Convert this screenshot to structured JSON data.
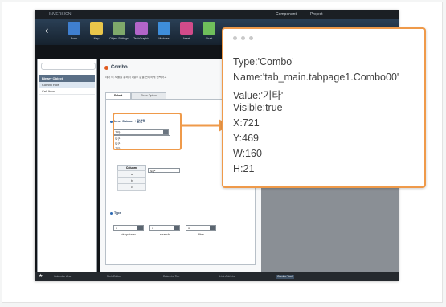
{
  "app": {
    "brand": "INVERSION",
    "top_items": [
      "Component",
      "Project"
    ],
    "toolbar_buttons": [
      {
        "label": "Form",
        "color": "#3f7fcf"
      },
      {
        "label": "Map",
        "color": "#e9c64a"
      },
      {
        "label": "Object Settings",
        "color": "#7fa96b"
      },
      {
        "label": "TechGraphic",
        "color": "#b265c9"
      },
      {
        "label": "Modules",
        "color": "#3e8edb"
      },
      {
        "label": "Asset",
        "color": "#d24b8a"
      },
      {
        "label": "Chart",
        "color": "#6fbf5b"
      }
    ]
  },
  "left_panel": {
    "header": "Binary Object",
    "items": [
      "Combo Row",
      "Cell Item"
    ]
  },
  "content": {
    "title": "Combo",
    "desc": "데이 터 모듈을 통해서 1월부 값을 편리하게 선택하고",
    "tabs": [
      "Select",
      "Show Option"
    ],
    "section1": "Inner Dataset + 값선택",
    "combo_value": "기타",
    "combo_options": [
      "도구",
      "도구",
      "기타"
    ],
    "grid_header": "Colunmt",
    "grid_rows": [
      "a",
      "b",
      "c"
    ],
    "mini_combo": "도구",
    "section2": "Type",
    "type_combo": [
      "1",
      "1",
      "1"
    ],
    "type_labels": [
      "dropdown",
      "search",
      "filter"
    ]
  },
  "statusbar": {
    "items": [
      "Calendar Ana",
      "Rich Editor",
      "Data List Tab",
      "Link Add List",
      "Combo Tool"
    ],
    "active": "Combo Tool"
  },
  "popup": {
    "lines": [
      "Type:'Combo'",
      "Name:'tab_main.tabpage1.Combo00'",
      "Value:'기타'",
      "Visible:true",
      "X:721",
      "Y:469",
      "W:160",
      "H:21"
    ]
  },
  "colors": {
    "accent": "#ef9a4a"
  }
}
